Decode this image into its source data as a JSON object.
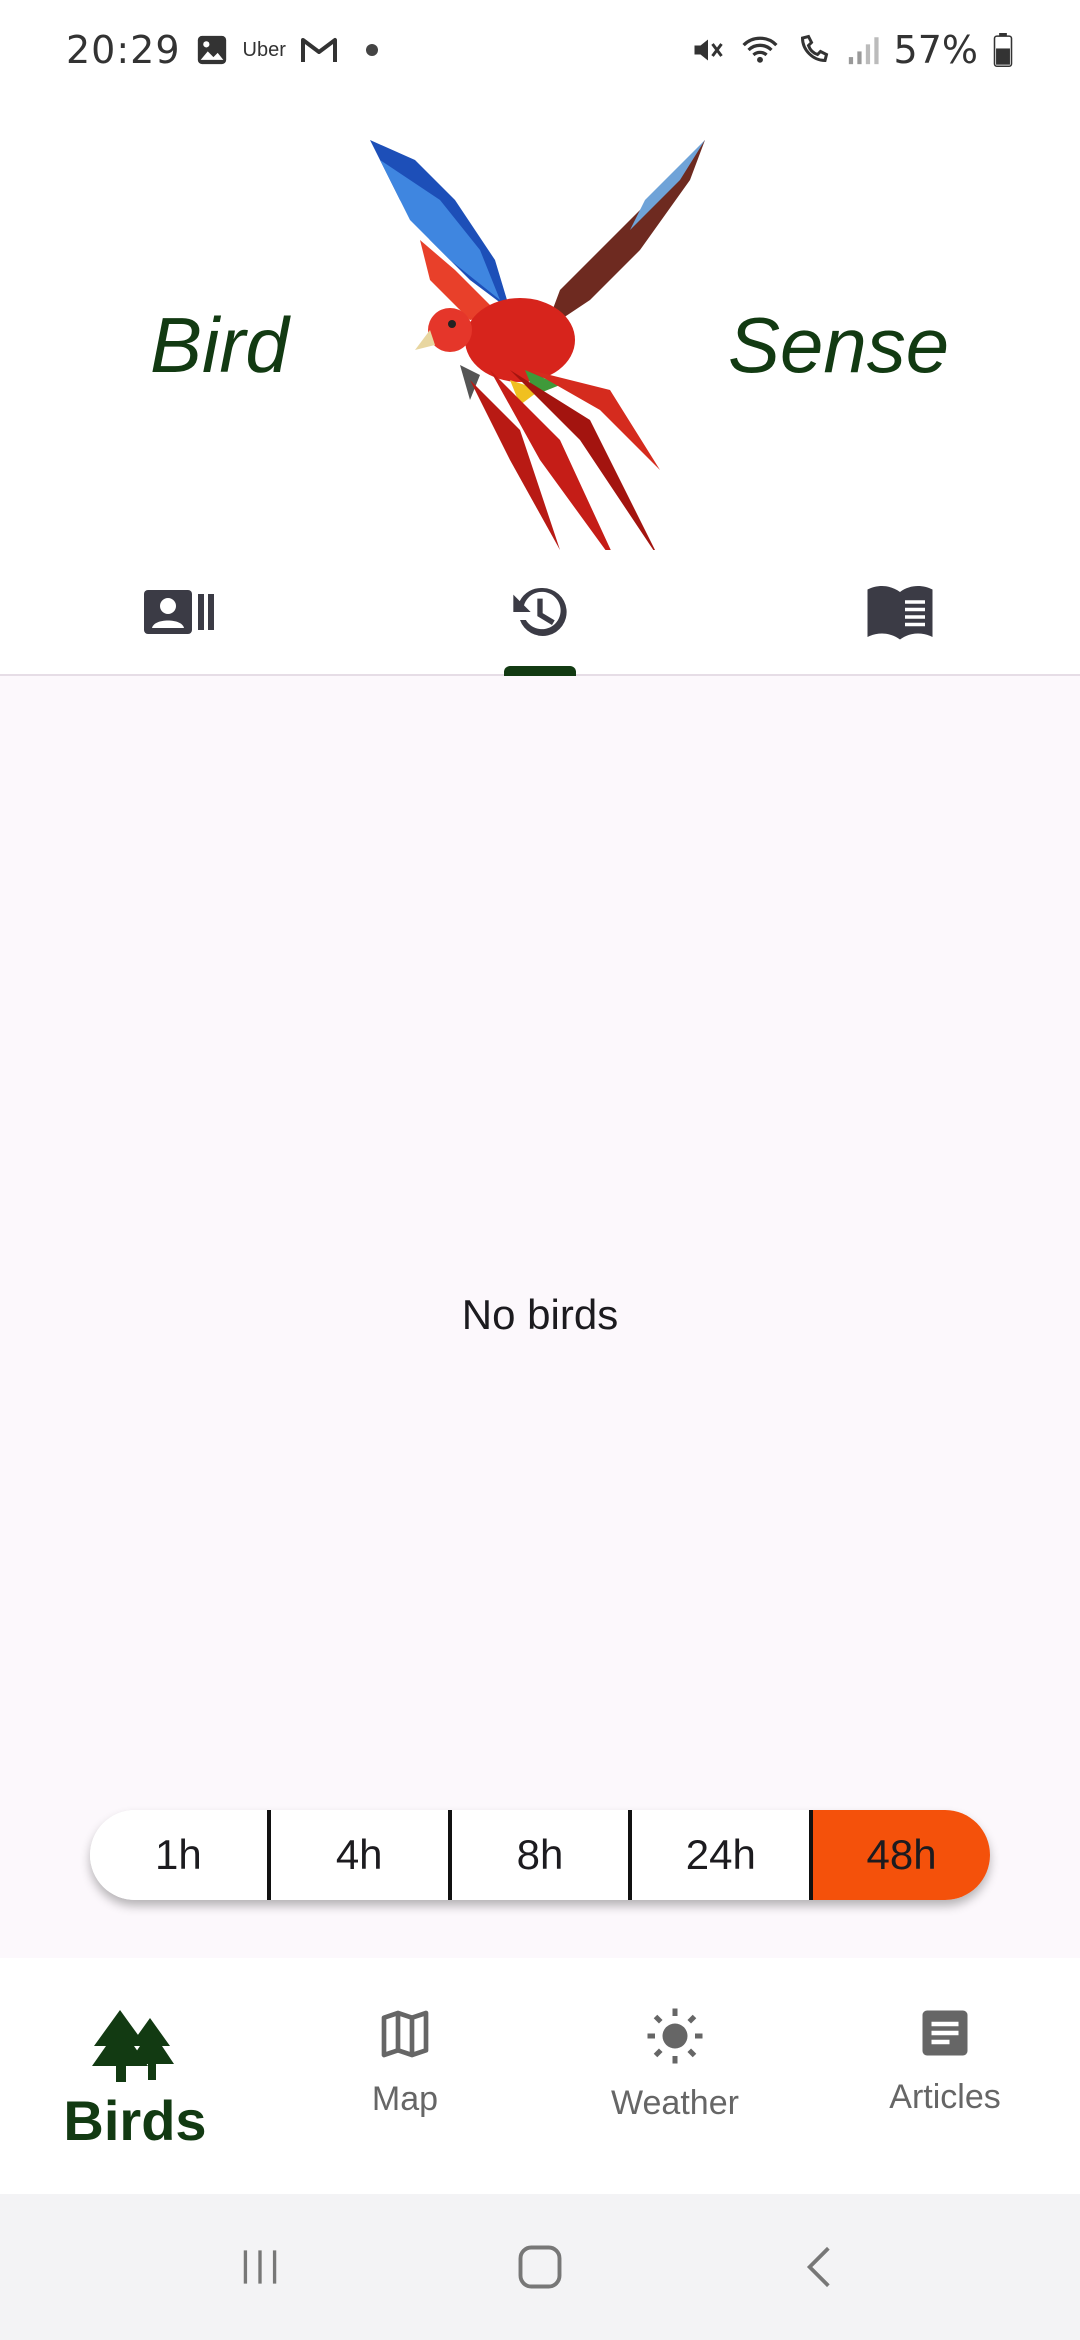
{
  "status_bar": {
    "time": "20:29",
    "uber": "Uber",
    "battery": "57%",
    "icons": [
      "image-icon",
      "uber-icon",
      "gmail-icon",
      "notification-dot",
      "mute-icon",
      "wifi-icon",
      "wifi-call-icon",
      "signal-icon",
      "battery-icon"
    ]
  },
  "header": {
    "title_left": "Bird",
    "title_right": "Sense"
  },
  "top_tabs": [
    {
      "icon": "contact-list-icon",
      "selected": false
    },
    {
      "icon": "history-icon",
      "selected": true
    },
    {
      "icon": "book-icon",
      "selected": false
    }
  ],
  "content": {
    "empty_text": "No birds"
  },
  "time_filters": {
    "options": [
      "1h",
      "4h",
      "8h",
      "24h",
      "48h"
    ],
    "selected": "48h",
    "active_color": "#f4510b"
  },
  "bottom_nav": {
    "items": [
      {
        "label": "Birds",
        "icon": "trees-icon",
        "selected": true
      },
      {
        "label": "Map",
        "icon": "map-icon",
        "selected": false
      },
      {
        "label": "Weather",
        "icon": "sun-icon",
        "selected": false
      },
      {
        "label": "Articles",
        "icon": "article-icon",
        "selected": false
      }
    ],
    "accent_color": "#123a12"
  },
  "system_nav": {
    "buttons": [
      "recents-icon",
      "home-icon",
      "back-icon"
    ]
  }
}
